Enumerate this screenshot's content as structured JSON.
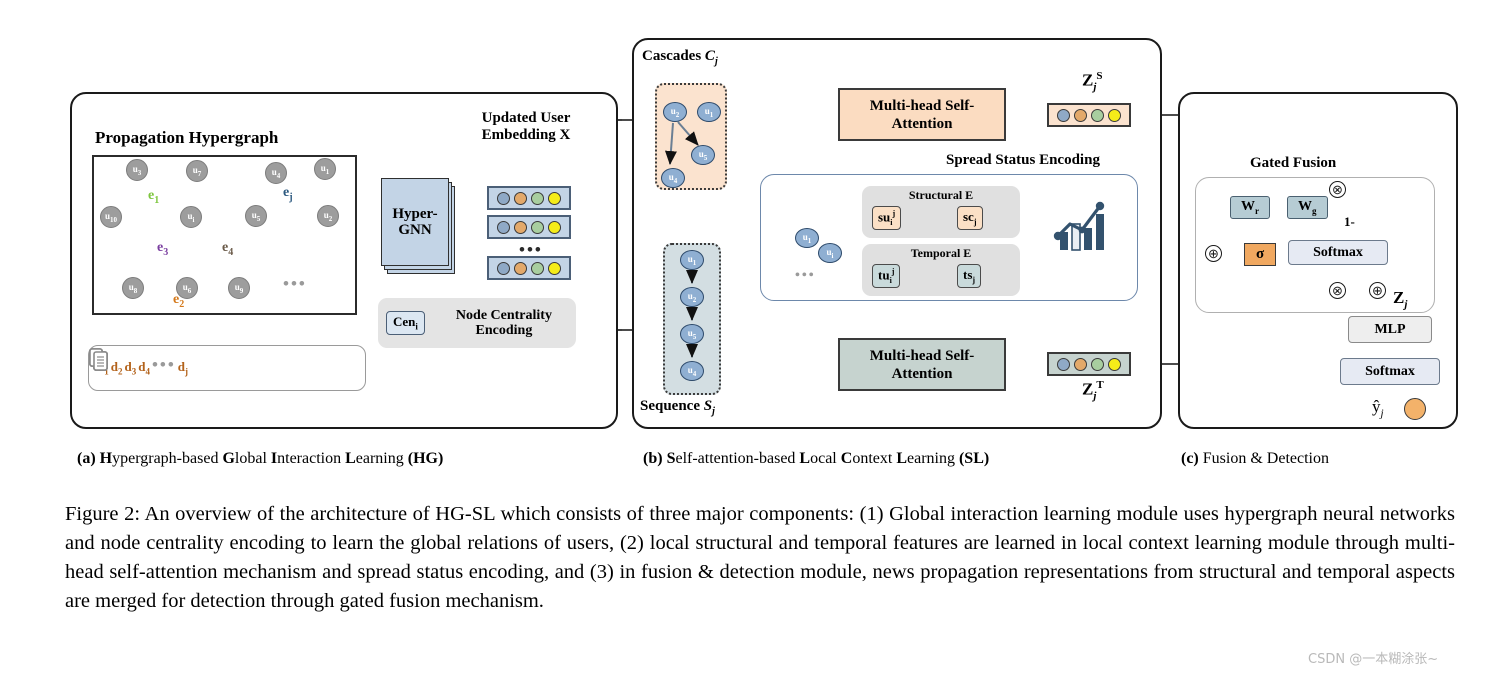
{
  "figure": {
    "caption": "Figure 2: An overview of the architecture of HG-SL which consists of three major components: (1) Global interaction learning module uses hypergraph neural networks and node centrality encoding to learn the global relations of users, (2) local structural and temporal features are learned in local context learning module through multi-head self-attention mechanism and spread status encoding, and (3) in fusion & detection module, news propagation representations from structural and temporal aspects are merged for detection through gated fusion mechanism.",
    "watermark": "CSDN @一本糊涂张~"
  },
  "panel_a": {
    "caption_prefix": "(a) ",
    "caption_h": "H",
    "caption_t1": "ypergraph-based ",
    "caption_g": "G",
    "caption_t2": "lobal ",
    "caption_i": "I",
    "caption_t3": "nteraction ",
    "caption_l": "L",
    "caption_t4": "earning ",
    "caption_tag": "(HG)",
    "title": "Propagation Hypergraph",
    "nodes": [
      {
        "id": "u3",
        "label": "u",
        "sub": "3"
      },
      {
        "id": "u7",
        "label": "u",
        "sub": "7"
      },
      {
        "id": "u10",
        "label": "u",
        "sub": "10"
      },
      {
        "id": "ui",
        "label": "u",
        "sub": "i"
      },
      {
        "id": "u8",
        "label": "u",
        "sub": "8"
      },
      {
        "id": "u6",
        "label": "u",
        "sub": "6"
      },
      {
        "id": "u9",
        "label": "u",
        "sub": "9"
      },
      {
        "id": "u4",
        "label": "u",
        "sub": "4"
      },
      {
        "id": "u1",
        "label": "u",
        "sub": "1"
      },
      {
        "id": "u5",
        "label": "u",
        "sub": "5"
      },
      {
        "id": "u2",
        "label": "u",
        "sub": "2"
      }
    ],
    "hyperedges": [
      {
        "id": "e1",
        "label": "e",
        "sub": "1",
        "color": "#7ec63f"
      },
      {
        "id": "e2",
        "label": "e",
        "sub": "2",
        "color": "#d4791b"
      },
      {
        "id": "e3",
        "label": "e",
        "sub": "3",
        "color": "#7b3fa0"
      },
      {
        "id": "e4",
        "label": "e",
        "sub": "4",
        "color": "#5a5a5a"
      },
      {
        "id": "ej",
        "label": "e",
        "sub": "j",
        "color": "#2d5a80"
      }
    ],
    "ellipsis": "•••",
    "documents": [
      {
        "label": "d",
        "sub": "1"
      },
      {
        "label": "d",
        "sub": "2"
      },
      {
        "label": "d",
        "sub": "3"
      },
      {
        "label": "d",
        "sub": "4"
      },
      {
        "label": "d",
        "sub": "j"
      }
    ],
    "doc_ellipsis": "•••",
    "hypergnn_label_line1": "Hyper-",
    "hypergnn_label_line2": "GNN",
    "updated_embedding_title": "Updated User Embedding X",
    "embedding_ellipsis": "•••",
    "centrality_chip": "Cen",
    "centrality_chip_sub": "i",
    "centrality_text": "Node Centrality Encoding"
  },
  "panel_b": {
    "caption_prefix": "(b) ",
    "caption_s": "S",
    "caption_t1": "elf-attention-based ",
    "caption_l": "L",
    "caption_t2": "ocal ",
    "caption_c": "C",
    "caption_t3": "ontext ",
    "caption_l2": "L",
    "caption_t4": "earning ",
    "caption_tag": "(SL)",
    "cascades_title": "Cascades",
    "cascades_symbol": "C",
    "cascades_sub": "j",
    "sequence_title": "Sequence",
    "sequence_symbol": "S",
    "sequence_sub": "j",
    "cascade_nodes": [
      {
        "label": "u",
        "sub": "2"
      },
      {
        "label": "u",
        "sub": "1"
      },
      {
        "label": "u",
        "sub": "5"
      },
      {
        "label": "u",
        "sub": "4"
      }
    ],
    "sequence_nodes": [
      {
        "label": "u",
        "sub": "1"
      },
      {
        "label": "u",
        "sub": "2"
      },
      {
        "label": "u",
        "sub": "5"
      },
      {
        "label": "u",
        "sub": "4"
      }
    ],
    "mha_structural": "Multi-head Self-Attention",
    "mha_temporal": "Multi-head Self-Attention",
    "spread_status_title": "Spread Status Encoding",
    "sse_nodes": [
      {
        "label": "u",
        "sub": "1"
      },
      {
        "label": "u",
        "sub": "i"
      }
    ],
    "sse_ellipsis": "•••",
    "structural_group": "Structural E",
    "temporal_group": "Temporal E",
    "chips": [
      {
        "id": "su",
        "label": "su",
        "sub": "i",
        "sup": "j",
        "kind": "structural"
      },
      {
        "id": "sc",
        "label": "sc",
        "sub": "j",
        "sup": "",
        "kind": "structural"
      },
      {
        "id": "tu",
        "label": "tu",
        "sub": "i",
        "sup": "j",
        "kind": "temporal"
      },
      {
        "id": "ts",
        "label": "ts",
        "sub": "j",
        "sup": "",
        "kind": "temporal"
      }
    ],
    "z_structural": "Z",
    "z_structural_sub": "j",
    "z_structural_sup": "S",
    "z_temporal": "Z",
    "z_temporal_sub": "j",
    "z_temporal_sup": "T",
    "chart_icon": "bar-chart-trend-icon"
  },
  "panel_c": {
    "caption_prefix": "(c) ",
    "caption_text": "Fusion & Detection",
    "gated_fusion_title": "Gated Fusion",
    "w_reset": "W",
    "w_reset_sub": "r",
    "w_gate": "W",
    "w_gate_sub": "g",
    "sigma": "σ",
    "softmax_gate": "Softmax",
    "one_minus": "1-",
    "z_out": "Z",
    "z_out_sub": "j",
    "mlp": "MLP",
    "softmax_out": "Softmax",
    "yhat": "ŷ",
    "yhat_sub": "j",
    "op_multiply": "⊗",
    "op_add": "⊕"
  },
  "colors": {
    "embedding_bar_fill": "#c3d4e6",
    "cascade_fill": "#fbe3cf",
    "sequence_fill": "#d3dee2",
    "mha_structural_fill": "#fbdcc1",
    "mha_temporal_fill": "#c6d3cf",
    "sigma_fill": "#f0a860",
    "weight_box_fill": "#b6ccd4",
    "yhat_fill": "#f3b26a",
    "dot_blue": "#8fa9c6",
    "dot_orange": "#e3a96a",
    "dot_green": "#a8ce9f",
    "dot_yellow": "#f5ec19"
  }
}
